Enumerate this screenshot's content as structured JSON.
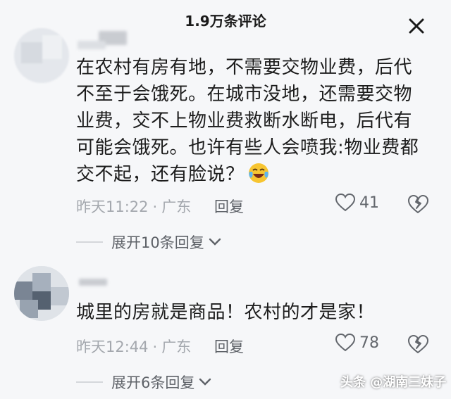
{
  "header": {
    "title": "1.9万条评论"
  },
  "comments": [
    {
      "lines": [
        "在农村有房有地，不需要交物业费，后代",
        "不至于会饿死。在城市没地，还需要交物",
        "业费，交不上物业费救断水断电，后代有",
        "可能会饿死。也许有些人会喷我:物业费都",
        "交不起，还有脸说？"
      ],
      "emoji": "laughing-crying-emoji",
      "time": "昨天11:22",
      "location": "广东",
      "reply_label": "回复",
      "likes": "41",
      "expand_label": "展开10条回复"
    },
    {
      "lines": [
        "城里的房就是商品！农村的才是家！"
      ],
      "time": "昨天12:44",
      "location": "广东",
      "reply_label": "回复",
      "likes": "78",
      "expand_label": "展开6条回复"
    }
  ],
  "meta_separator": "·",
  "watermark": "头条 @湖南三妹子",
  "colors": {
    "background": "#f6f7f9",
    "text": "#1c1c1c",
    "meta": "#a4a8ae",
    "accent": "#63676d"
  }
}
